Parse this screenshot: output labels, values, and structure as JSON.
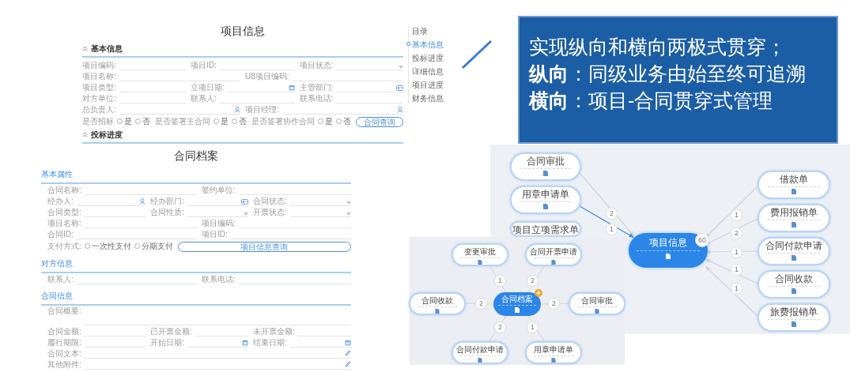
{
  "project_form": {
    "title": "项目信息",
    "sections": [
      {
        "title": "基本信息",
        "expanded": true,
        "rows": [
          [
            {
              "label": "项目编码:",
              "kind": "text"
            },
            {
              "label": "项目ID:",
              "kind": "text"
            },
            {
              "label": "项目状态:",
              "kind": "select"
            }
          ],
          [
            {
              "label": "项目名称:",
              "kind": "text"
            },
            {
              "label": "U8项目编码:",
              "kind": "text"
            }
          ],
          [
            {
              "label": "项目类型:",
              "kind": "text"
            },
            {
              "label": "立项日期:",
              "kind": "date"
            },
            {
              "label": "主管部门:",
              "kind": "dept"
            }
          ],
          [
            {
              "label": "对方单位:",
              "kind": "text"
            },
            {
              "label": "联系人:",
              "kind": "text"
            },
            {
              "label": "联系电话:",
              "kind": "text"
            }
          ],
          [
            {
              "label": "总负责人:",
              "kind": "person"
            },
            {
              "label": "项目经理:",
              "kind": "person"
            }
          ],
          [
            {
              "label": "是否招标",
              "kind": "radio",
              "options": [
                {
                  "label": "是",
                  "selected": false
                },
                {
                  "label": "否",
                  "selected": false
                }
              ]
            },
            {
              "label": "是否签署主合同",
              "kind": "radio",
              "options": [
                {
                  "label": "是",
                  "selected": false
                },
                {
                  "label": "否",
                  "selected": false
                }
              ]
            },
            {
              "label": "是否签署协作合同",
              "kind": "radio",
              "options": [
                {
                  "label": "是",
                  "selected": false
                },
                {
                  "label": "否",
                  "selected": false
                }
              ]
            },
            {
              "label": "合同查询",
              "kind": "button"
            }
          ]
        ]
      },
      {
        "title": "投标进度",
        "expanded": true
      }
    ]
  },
  "toc": {
    "title": "目录",
    "items": [
      {
        "label": "基本信息",
        "selected": true
      },
      {
        "label": "投标进度",
        "selected": false
      },
      {
        "label": "详细信息",
        "selected": false
      },
      {
        "label": "项目进度",
        "selected": false
      },
      {
        "label": "财务信息",
        "selected": false
      }
    ]
  },
  "callout": {
    "lines": [
      "实现纵向和横向两极式贯穿；",
      "**纵向**：同级业务由始至终可追溯",
      "**横向**：项目-合同贯穿式管理"
    ]
  },
  "contract_form": {
    "title": "合同档案",
    "sections": [
      {
        "title": "基本属性",
        "rows": [
          [
            {
              "label": "合同名称:",
              "kind": "text"
            },
            {
              "label": "签约单位:",
              "kind": "text"
            }
          ],
          [
            {
              "label": "经办人:",
              "kind": "person"
            },
            {
              "label": "经办部门:",
              "kind": "dept"
            },
            {
              "label": "合同状态:",
              "kind": "select"
            }
          ],
          [
            {
              "label": "合同类型:",
              "kind": "text"
            },
            {
              "label": "合同性质:",
              "kind": "select"
            },
            {
              "label": "开票状态:",
              "kind": "select"
            }
          ],
          [
            {
              "label": "项目名称:",
              "kind": "text"
            },
            {
              "label": "项目编码:",
              "kind": "text"
            }
          ],
          [
            {
              "label": "合同ID:",
              "kind": "text"
            },
            {
              "label": "项目ID:",
              "kind": "text"
            }
          ],
          [
            {
              "label": "支付方式:",
              "kind": "radio",
              "options": [
                {
                  "label": "一次性支付",
                  "selected": false
                },
                {
                  "label": "分期支付",
                  "selected": false
                }
              ]
            },
            "",
            {
              "label": "项目信息查询",
              "kind": "button"
            }
          ]
        ]
      },
      {
        "title": "对方信息",
        "rows": [
          [
            {
              "label": "联系人:",
              "kind": "text"
            },
            {
              "label": "联系电话:",
              "kind": "text"
            }
          ]
        ]
      },
      {
        "title": "合同信息",
        "rows": [
          [
            {
              "label": "合同概要:",
              "kind": "textarea"
            }
          ],
          [
            {
              "label": "合同金额:",
              "kind": "text"
            },
            {
              "label": "已开票金额:",
              "kind": "text"
            },
            {
              "label": "未开票金额:",
              "kind": "text"
            }
          ],
          [
            {
              "label": "履行期限:",
              "kind": "text"
            },
            {
              "label": "开始日期:",
              "kind": "date"
            },
            {
              "label": "结束日期:",
              "kind": "date"
            }
          ],
          [
            {
              "label": "合同文本:",
              "kind": "attach"
            }
          ],
          [
            {
              "label": "其他附件:",
              "kind": "attach"
            }
          ]
        ]
      }
    ]
  },
  "project_map": {
    "center": {
      "label": "项目信息",
      "badge": "60"
    },
    "left_nodes": [
      {
        "label": "合同审批",
        "count": "2",
        "highlighted": false
      },
      {
        "label": "用章申请单",
        "count": "1",
        "highlighted": true
      },
      {
        "label": "项目立项需求单"
      }
    ],
    "right_nodes": [
      {
        "label": "借款单",
        "count": "1",
        "highlighted": false
      },
      {
        "label": "费用报销单",
        "count": "2",
        "highlighted": false
      },
      {
        "label": "合同付款申请",
        "count": "1",
        "highlighted": false
      },
      {
        "label": "合同收款",
        "count": "1",
        "highlighted": false
      },
      {
        "label": "旅费报销单",
        "count": "1",
        "highlighted": false
      }
    ]
  },
  "contract_map": {
    "center": {
      "label": "合同档案"
    },
    "nodes": [
      {
        "label": "变更审批",
        "count": "1"
      },
      {
        "label": "合同开票申请",
        "count": "2"
      },
      {
        "label": "合同收款",
        "count": "2"
      },
      {
        "label": "合同审批",
        "count": "2"
      },
      {
        "label": "合同付款申请",
        "count": "2"
      },
      {
        "label": "用章申请单",
        "count": "1"
      }
    ]
  }
}
